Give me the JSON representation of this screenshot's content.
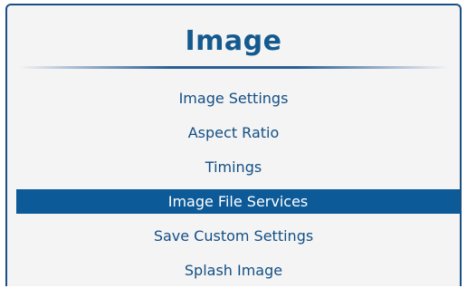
{
  "panel": {
    "title": "Image"
  },
  "menu": {
    "items": [
      {
        "label": "Image Settings",
        "selected": false
      },
      {
        "label": "Aspect Ratio",
        "selected": false
      },
      {
        "label": "Timings",
        "selected": false
      },
      {
        "label": "Image File Services",
        "selected": true
      },
      {
        "label": "Save Custom Settings",
        "selected": false
      },
      {
        "label": "Splash Image",
        "selected": false
      }
    ]
  },
  "colors": {
    "accent": "#0d5a98",
    "text": "#134f85",
    "background": "#f4f4f4"
  }
}
